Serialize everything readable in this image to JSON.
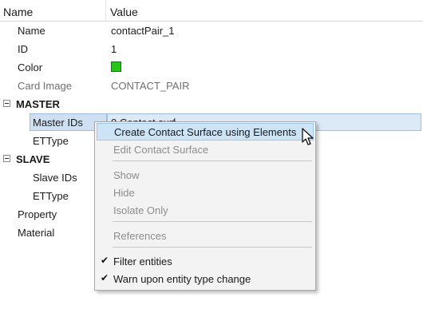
{
  "header": {
    "name_label": "Name",
    "value_label": "Value"
  },
  "properties": [
    {
      "key": "Name",
      "value": "contactPair_1",
      "muted": false
    },
    {
      "key": "ID",
      "value": "1",
      "muted": false
    },
    {
      "key": "Color",
      "value": "",
      "muted": false
    },
    {
      "key": "Card Image",
      "value": "CONTACT_PAIR",
      "muted": true
    }
  ],
  "color_value": "#27c516",
  "master": {
    "label": "MASTER",
    "ids_label": "Master IDs",
    "ids_value": "0 Contact surf",
    "ettype_label": "ETType"
  },
  "slave": {
    "label": "SLAVE",
    "ids_label": "Slave IDs",
    "ettype_label": "ETType"
  },
  "property_label": "Property",
  "material_label": "Material",
  "context_menu": {
    "items": [
      {
        "label": "Create Contact Surface using Elements",
        "state": "highlighted"
      },
      {
        "label": "Edit Contact Surface",
        "state": "disabled"
      },
      {
        "label": "Show",
        "state": "disabled"
      },
      {
        "label": "Hide",
        "state": "disabled"
      },
      {
        "label": "Isolate Only",
        "state": "disabled"
      },
      {
        "label": "References",
        "state": "disabled"
      },
      {
        "label": "Filter entities",
        "state": "checked"
      },
      {
        "label": "Warn upon entity type change",
        "state": "checked"
      }
    ]
  }
}
